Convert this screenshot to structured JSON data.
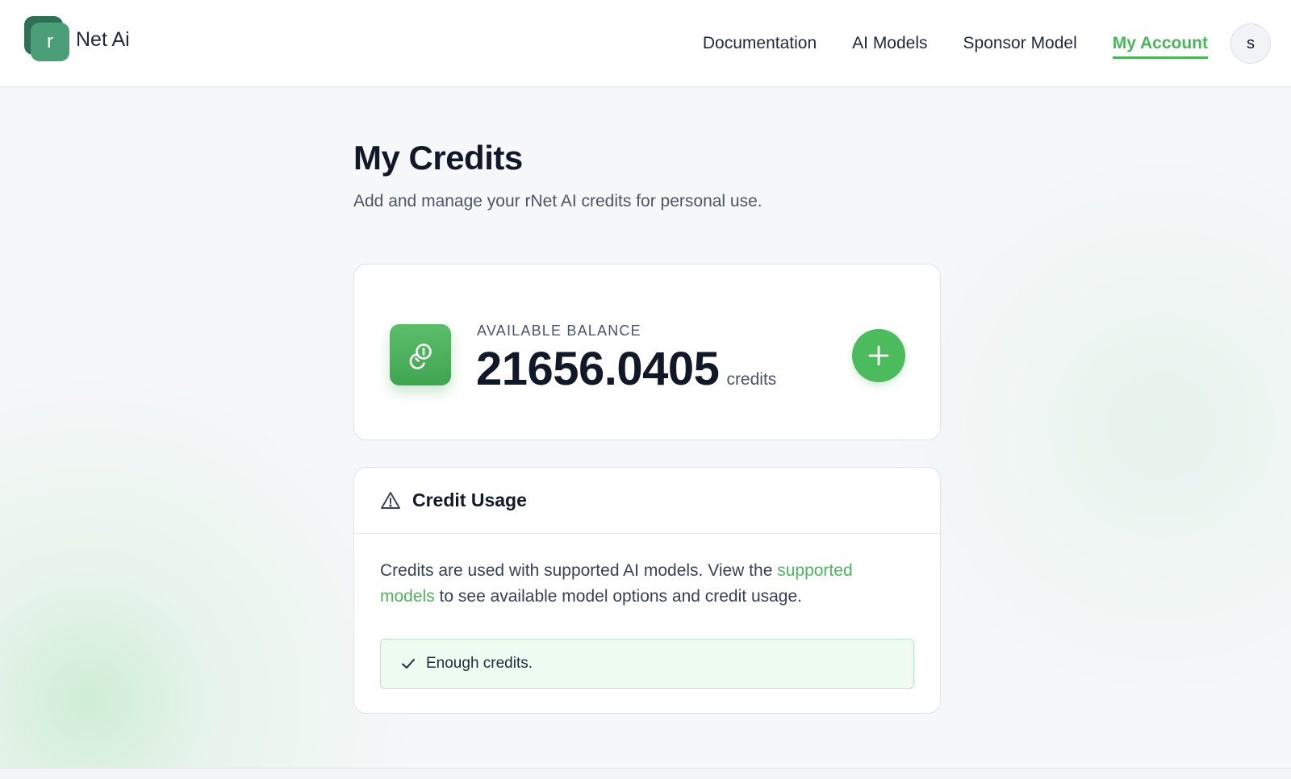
{
  "colors": {
    "accent": "#4bb45d",
    "logo_dark": "#2f6f55",
    "logo_light": "#4a9e78",
    "status_bg": "#effcf1"
  },
  "header": {
    "logo_letter": "r",
    "logo_text": "Net Ai",
    "nav": [
      {
        "label": "Documentation",
        "active": false
      },
      {
        "label": "AI Models",
        "active": false
      },
      {
        "label": "Sponsor Model",
        "active": false
      },
      {
        "label": "My Account",
        "active": true
      }
    ],
    "avatar_initial": "s"
  },
  "page": {
    "title": "My Credits",
    "subtitle": "Add and manage your rNet AI credits for personal use."
  },
  "balance": {
    "icon": "coins-icon",
    "label": "AVAILABLE BALANCE",
    "value": "21656.0405",
    "unit": "credits",
    "add_icon": "plus-icon"
  },
  "usage": {
    "icon": "warning-triangle-icon",
    "title": "Credit Usage",
    "text_before": "Credits are used with supported AI models. View the ",
    "link_text": "supported models",
    "text_after": " to see available model options and credit usage.",
    "status_icon": "check-icon",
    "status_text": "Enough credits."
  }
}
